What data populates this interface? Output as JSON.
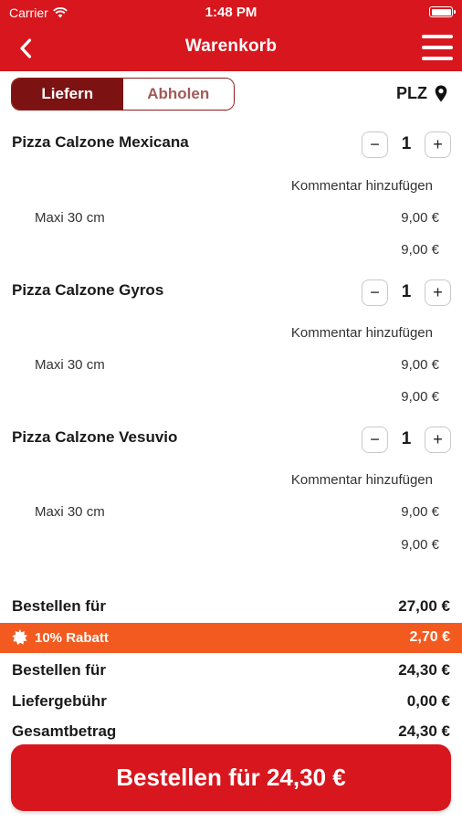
{
  "status_bar": {
    "carrier": "Carrier",
    "time": "1:48 PM"
  },
  "nav": {
    "title": "Warenkorb"
  },
  "mode": {
    "deliver": "Liefern",
    "pickup": "Abholen",
    "selected": "Liefern"
  },
  "location": {
    "label": "PLZ"
  },
  "cart": {
    "items": [
      {
        "name": "Pizza Calzone Mexicana",
        "quantity": "1",
        "minus": "−",
        "plus": "+",
        "comment": "Kommentar hinzufügen",
        "size": "Maxi 30 cm",
        "unit_price": "9,00 €",
        "total": "9,00 €"
      },
      {
        "name": "Pizza Calzone Gyros",
        "quantity": "1",
        "minus": "−",
        "plus": "+",
        "comment": "Kommentar hinzufügen",
        "size": "Maxi 30 cm",
        "unit_price": "9,00 €",
        "total": "9,00 €"
      },
      {
        "name": "Pizza Calzone Vesuvio",
        "quantity": "1",
        "minus": "−",
        "plus": "+",
        "comment": "Kommentar hinzufügen",
        "size": "Maxi 30 cm",
        "unit_price": "9,00 €",
        "total": "9,00 €"
      }
    ]
  },
  "summary": {
    "subtotal_label": "Bestellen für",
    "subtotal_value": "27,00 €",
    "discount_label": "10% Rabatt",
    "discount_value": "2,70 €",
    "after_discount_label": "Bestellen für",
    "after_discount_value": "24,30 €",
    "delivery_fee_label": "Liefergebühr",
    "delivery_fee_value": "0,00 €",
    "total_label": "Gesamtbetrag",
    "total_value": "24,30 €"
  },
  "order_button": {
    "label": "Bestellen für 24,30 €"
  },
  "colors": {
    "primary": "#d8161e",
    "segment_active": "#7d1212",
    "discount": "#f35a1f"
  },
  "icons": {
    "back": "chevron-left-icon",
    "menu": "hamburger-menu-icon",
    "location": "location-pin-icon",
    "discount": "badge-burst-icon",
    "wifi": "wifi-icon",
    "battery": "battery-icon"
  }
}
